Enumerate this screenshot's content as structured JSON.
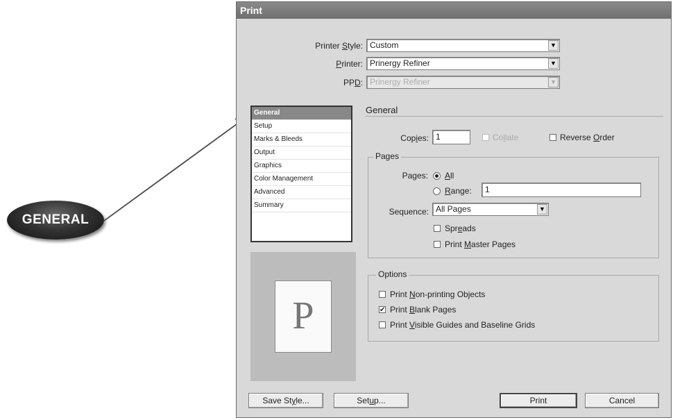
{
  "callout": {
    "label": "GENERAL"
  },
  "dialog": {
    "title": "Print",
    "printer_style": {
      "label_pre": "Printer ",
      "label_key": "S",
      "label_post": "tyle:",
      "value": "Custom"
    },
    "printer": {
      "label_pre": "",
      "label_key": "P",
      "label_post": "rinter:",
      "value": "Prinergy Refiner"
    },
    "ppd": {
      "label_pre": "PP",
      "label_key": "D",
      "label_post": ":",
      "value": "Prinergy Refiner"
    },
    "categories": [
      "General",
      "Setup",
      "Marks & Bleeds",
      "Output",
      "Graphics",
      "Color Management",
      "Advanced",
      "Summary"
    ],
    "selected_category": "General",
    "preview_letter": "P",
    "section_title": "General",
    "copies": {
      "label_pre": "Cop",
      "label_key": "i",
      "label_post": "es:",
      "value": "1"
    },
    "collate": {
      "label_pre": "Co",
      "label_key": "l",
      "label_post": "late",
      "checked": false,
      "enabled": false
    },
    "reverse_order": {
      "label_pre": "Reverse ",
      "label_key": "O",
      "label_post": "rder",
      "checked": false
    },
    "pages_group": {
      "legend": "Pages",
      "pages_label_pre": "Pa",
      "pages_label_key": "g",
      "pages_label_post": "es:",
      "all": {
        "label_pre": "",
        "label_key": "A",
        "label_post": "ll",
        "selected": true
      },
      "range": {
        "label_pre": "",
        "label_key": "R",
        "label_post": "ange:",
        "selected": false,
        "value": "1"
      },
      "sequence_label": "Sequence:",
      "sequence_value": "All Pages",
      "spreads": {
        "label_pre": "Spr",
        "label_key": "e",
        "label_post": "ads",
        "checked": false
      },
      "print_master": {
        "label_pre": "Print ",
        "label_key": "M",
        "label_post": "aster Pages",
        "checked": false
      }
    },
    "options_group": {
      "legend": "Options",
      "non_printing": {
        "label_pre": "Print ",
        "label_key": "N",
        "label_post": "on-printing Objects",
        "checked": false
      },
      "blank_pages": {
        "label_pre": "Print ",
        "label_key": "B",
        "label_post": "lank Pages",
        "checked": true
      },
      "visible_guides": {
        "label_pre": "Print ",
        "label_key": "V",
        "label_post": "isible Guides and Baseline Grids",
        "checked": false
      }
    },
    "buttons": {
      "save_style": {
        "pre": "Save St",
        "key": "y",
        "post": "le..."
      },
      "setup": {
        "pre": "Set",
        "key": "u",
        "post": "p..."
      },
      "print": "Print",
      "cancel": "Cancel"
    },
    "dropdown_glyph": "▼",
    "check_glyph": "✔"
  }
}
